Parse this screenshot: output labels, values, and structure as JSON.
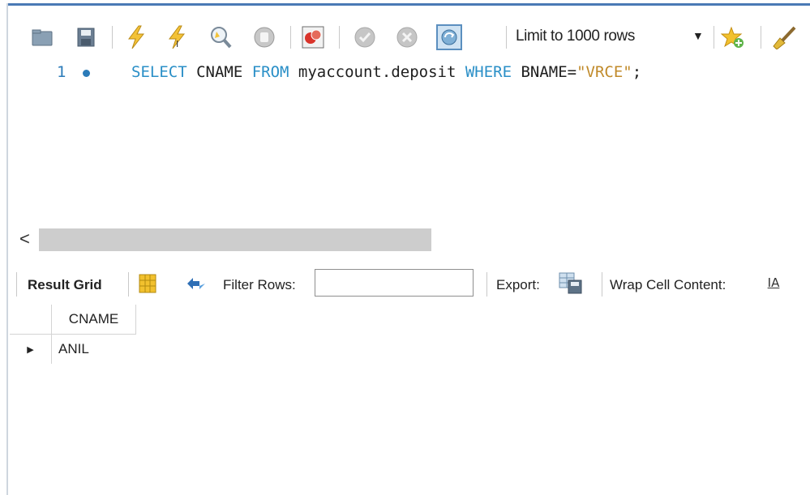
{
  "toolbar": {
    "limit_label": "Limit to 1000 rows",
    "buttons": [
      "open-file",
      "save-file",
      "execute",
      "execute-current",
      "explain",
      "stop",
      "toggle-error",
      "commit",
      "rollback",
      "autocommit",
      "limit-dropdown",
      "bookmark",
      "beautify"
    ]
  },
  "editor": {
    "line_number": "1",
    "kw_select": "SELECT",
    "col": " CNAME ",
    "kw_from": "FROM",
    "table": " myaccount.deposit ",
    "kw_where": "WHERE",
    "cond": " BNAME=",
    "str_val": "\"VRCE\"",
    "end": ";"
  },
  "scrollbar": {
    "left_arrow": "<"
  },
  "results_toolbar": {
    "result_grid_label": "Result Grid",
    "filter_label": "Filter Rows:",
    "filter_value": "",
    "export_label": "Export:",
    "wrap_label": "Wrap Cell Content:",
    "wrap_icon_text": "IA"
  },
  "grid": {
    "columns": [
      "CNAME"
    ],
    "rows": [
      [
        "ANIL"
      ]
    ],
    "row_marker": "▶"
  },
  "colors": {
    "keyword": "#2a8fc7",
    "string": "#c08a2a",
    "line_number": "#2b7bb9"
  }
}
